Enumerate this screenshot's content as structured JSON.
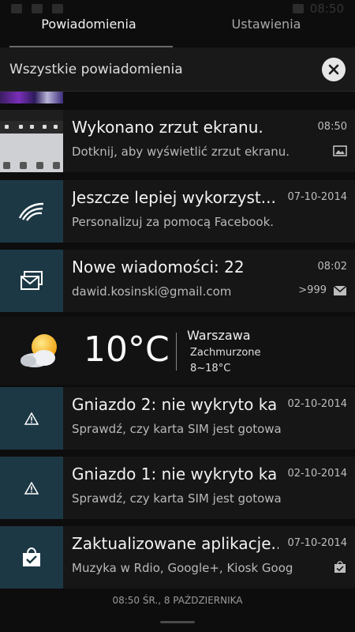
{
  "status_bar": {
    "time": "08:50"
  },
  "tabs": [
    {
      "label": "Powiadomienia",
      "active": true
    },
    {
      "label": "Ustawienia",
      "active": false
    }
  ],
  "header": {
    "title": "Wszystkie powiadomienia",
    "clear_icon": "close-icon"
  },
  "notifications": [
    {
      "title": "Wykonano zrzut ekranu.",
      "text": "Dotknij, aby wyświetlić zrzut ekranu.",
      "time": "08:50",
      "app_icon": "screenshot-thumbnail",
      "meta_icon": "image-icon"
    },
    {
      "title": "Jeszcze lepiej wykorzyst...",
      "text": "Personalizuj za pomocą Facebook.",
      "time": "07-10-2014",
      "app_icon": "swiftkey-icon"
    },
    {
      "title": "Nowe wiadomości: 22",
      "text": "dawid.kosinski@gmail.com",
      "time": "08:02",
      "count": ">999",
      "app_icon": "mail-stack-icon",
      "meta_icon": "mail-icon"
    },
    {
      "title": "Gniazdo 2: nie wykryto ka...",
      "text": "Sprawdź, czy karta SIM jest gotowa",
      "time": "02-10-2014",
      "app_icon": "warning-icon"
    },
    {
      "title": "Gniazdo 1: nie wykryto ka...",
      "text": "Sprawdź, czy karta SIM jest gotowa",
      "time": "02-10-2014",
      "app_icon": "warning-icon"
    },
    {
      "title": "Zaktualizowane aplikacje...",
      "text": "Muzyka w Rdio, Google+, Kiosk Google...",
      "time": "07-10-2014",
      "app_icon": "store-check-icon",
      "meta_icon": "bag-check-icon"
    }
  ],
  "weather": {
    "temperature": "10°C",
    "city": "Warszawa",
    "condition": "Zachmurzone",
    "range": "8~18°C",
    "icon": "partly-cloudy-icon"
  },
  "footer": {
    "datetime": "08:50  ŚR., 8 PAŹDZIERNIKA"
  },
  "colors": {
    "background": "#0d0d0d",
    "panel": "#161616",
    "icon_tile": "#1d3845",
    "header": "#191919"
  }
}
